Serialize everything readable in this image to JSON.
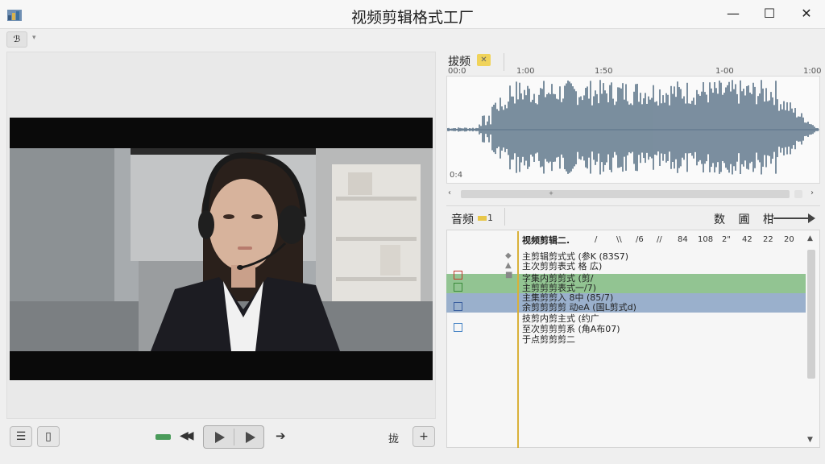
{
  "window": {
    "title": "视频剪辑格式工厂",
    "minimize": "—",
    "maximize": "☐",
    "close": "✕"
  },
  "toolbar": {
    "menu_icon_label": "ℬ",
    "caret": "▾"
  },
  "waveform": {
    "title": "拔频",
    "ruler": [
      "00:0",
      "1:00",
      "1:50",
      "1-00",
      "1:00"
    ],
    "corner_top": "0:0",
    "corner_bottom": "0:4",
    "wave_color": "#5b7388"
  },
  "audio": {
    "label": "音频",
    "badge": "1",
    "right_label": "数 圃 柑"
  },
  "subtitles": {
    "toolbar": [
      "/",
      "\\\\",
      "/6",
      "//",
      "84",
      "108",
      "2\"",
      "42",
      "22",
      "20"
    ],
    "header": "视频剪辑二.",
    "rows": [
      {
        "text": "主剪辑剪式式 (参K (83S7)",
        "highlight": "none",
        "checkbox": "none"
      },
      {
        "text": "主次剪剪表式 格 広)",
        "highlight": "none",
        "checkbox": "red"
      },
      {
        "text": "字集内剪剪式 (剪/",
        "highlight": "green",
        "checkbox": "green"
      },
      {
        "text": "主剪剪剪表式一/7)",
        "highlight": "green",
        "checkbox": "none"
      },
      {
        "text": "主集剪剪入 8中 (85/7)",
        "highlight": "blue",
        "checkbox": "blue"
      },
      {
        "text": "余剪剪剪剪 动eA (国L剪式d)",
        "highlight": "blue",
        "checkbox": "none"
      },
      {
        "text": "技剪内剪主式 (约广",
        "highlight": "none",
        "checkbox": "lightblue"
      },
      {
        "text": "至次剪剪剪系 (角A布07)",
        "highlight": "none",
        "checkbox": "none"
      },
      {
        "text": "于点剪剪剪二",
        "highlight": "none",
        "checkbox": "none"
      }
    ]
  },
  "player": {
    "list_icon": "☰",
    "phone_icon": "▯",
    "play_icon": "play-icon",
    "rewind_icon": "◀◀",
    "forward_icon": "➔",
    "extra_text": "拢",
    "plus_icon": "+"
  }
}
